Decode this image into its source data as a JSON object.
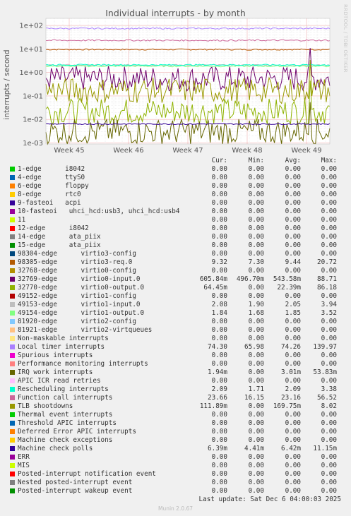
{
  "chart_data": {
    "type": "line",
    "title": "Individual interrupts - by month",
    "side_label": "RRDTOOL / TOBI OETIKER",
    "ylabel": "interrupts / second",
    "y_scale": "log",
    "ylim": [
      0.0009,
      200
    ],
    "y_ticks": [
      "1e+02",
      "1e+01",
      "1e+00",
      "1e-01",
      "1e-02",
      "1e-03"
    ],
    "x_ticks": [
      "Week 45",
      "Week 46",
      "Week 47",
      "Week 48",
      "Week 49"
    ],
    "grid": true,
    "legend_headers": [
      "Cur:",
      "Min:",
      "Avg:",
      "Max:"
    ],
    "series": [
      {
        "name": "1-edge      i8042",
        "color": "#00cc00",
        "values": [
          "0.00",
          "0.00",
          "0.00",
          "0.00"
        ]
      },
      {
        "name": "4-edge      ttyS0",
        "color": "#0066b3",
        "values": [
          "0.00",
          "0.00",
          "0.00",
          "0.00"
        ]
      },
      {
        "name": "6-edge      floppy",
        "color": "#ff8000",
        "values": [
          "0.00",
          "0.00",
          "0.00",
          "0.00"
        ]
      },
      {
        "name": "8-edge      rtc0",
        "color": "#ffcc00",
        "values": [
          "0.00",
          "0.00",
          "0.00",
          "0.00"
        ]
      },
      {
        "name": "9-fasteoi   acpi",
        "color": "#330099",
        "values": [
          "0.00",
          "0.00",
          "0.00",
          "0.00"
        ]
      },
      {
        "name": "10-fasteoi   uhci_hcd:usb3, uhci_hcd:usb4",
        "color": "#990099",
        "values": [
          "0.00",
          "0.00",
          "0.00",
          "0.00"
        ]
      },
      {
        "name": "11",
        "color": "#ccff00",
        "values": [
          "0.00",
          "0.00",
          "0.00",
          "0.00"
        ]
      },
      {
        "name": "12-edge      i8042",
        "color": "#ff0000",
        "values": [
          "0.00",
          "0.00",
          "0.00",
          "0.00"
        ]
      },
      {
        "name": "14-edge      ata_piix",
        "color": "#808080",
        "values": [
          "0.00",
          "0.00",
          "0.00",
          "0.00"
        ]
      },
      {
        "name": "15-edge      ata_piix",
        "color": "#008f00",
        "values": [
          "0.00",
          "0.00",
          "0.00",
          "0.00"
        ]
      },
      {
        "name": "98304-edge      virtio3-config",
        "color": "#00487d",
        "values": [
          "0.00",
          "0.00",
          "0.00",
          "0.00"
        ]
      },
      {
        "name": "98305-edge      virtio3-req.0",
        "color": "#b35a00",
        "values": [
          "9.32",
          "7.30",
          "9.44",
          "20.72"
        ]
      },
      {
        "name": "32768-edge      virtio0-config",
        "color": "#b38f00",
        "values": [
          "0.00",
          "0.00",
          "0.00",
          "0.00"
        ]
      },
      {
        "name": "32769-edge      virtio0-input.0",
        "color": "#6b006b",
        "values": [
          "605.84m",
          "496.70m",
          "543.58m",
          "88.71"
        ]
      },
      {
        "name": "32770-edge      virtio0-output.0",
        "color": "#8fb300",
        "values": [
          "64.45m",
          "0.00",
          "22.39m",
          "86.18"
        ]
      },
      {
        "name": "49152-edge      virtio1-config",
        "color": "#b30000",
        "values": [
          "0.00",
          "0.00",
          "0.00",
          "0.00"
        ]
      },
      {
        "name": "49153-edge      virtio1-input.0",
        "color": "#bebebe",
        "values": [
          "2.08",
          "1.90",
          "2.05",
          "3.94"
        ]
      },
      {
        "name": "49154-edge      virtio1-output.0",
        "color": "#80ff80",
        "values": [
          "1.84",
          "1.68",
          "1.85",
          "3.52"
        ]
      },
      {
        "name": "81920-edge      virtio2-config",
        "color": "#80c9ff",
        "values": [
          "0.00",
          "0.00",
          "0.00",
          "0.00"
        ]
      },
      {
        "name": "81921-edge      virtio2-virtqueues",
        "color": "#ffc080",
        "values": [
          "0.00",
          "0.00",
          "0.00",
          "0.00"
        ]
      },
      {
        "name": "Non-maskable interrupts",
        "color": "#ffe680",
        "values": [
          "0.00",
          "0.00",
          "0.00",
          "0.00"
        ]
      },
      {
        "name": "Local timer interrupts",
        "color": "#aa80ff",
        "values": [
          "74.30",
          "65.98",
          "74.26",
          "139.97"
        ]
      },
      {
        "name": "Spurious interrupts",
        "color": "#ee00cc",
        "values": [
          "0.00",
          "0.00",
          "0.00",
          "0.00"
        ]
      },
      {
        "name": "Performance monitoring interrupts",
        "color": "#ff8080",
        "values": [
          "0.00",
          "0.00",
          "0.00",
          "0.00"
        ]
      },
      {
        "name": "IRQ work interrupts",
        "color": "#666600",
        "values": [
          "1.94m",
          "0.00",
          "3.01m",
          "53.83m"
        ]
      },
      {
        "name": "APIC ICR read retries",
        "color": "#ffbfff",
        "values": [
          "0.00",
          "0.00",
          "0.00",
          "0.00"
        ]
      },
      {
        "name": "Rescheduling interrupts",
        "color": "#00ffcc",
        "values": [
          "2.09",
          "1.71",
          "2.09",
          "3.38"
        ]
      },
      {
        "name": "Function call interrupts",
        "color": "#cc6699",
        "values": [
          "23.66",
          "16.15",
          "23.16",
          "56.52"
        ]
      },
      {
        "name": "TLB shootdowns",
        "color": "#999900",
        "values": [
          "111.89m",
          "0.00",
          "169.75m",
          "8.02"
        ]
      },
      {
        "name": "Thermal event interrupts",
        "color": "#00cc00",
        "values": [
          "0.00",
          "0.00",
          "0.00",
          "0.00"
        ]
      },
      {
        "name": "Threshold APIC interrupts",
        "color": "#0066b3",
        "values": [
          "0.00",
          "0.00",
          "0.00",
          "0.00"
        ]
      },
      {
        "name": "Deferred Error APIC interrupts",
        "color": "#ff8000",
        "values": [
          "0.00",
          "0.00",
          "0.00",
          "0.00"
        ]
      },
      {
        "name": "Machine check exceptions",
        "color": "#ffcc00",
        "values": [
          "0.00",
          "0.00",
          "0.00",
          "0.00"
        ]
      },
      {
        "name": "Machine check polls",
        "color": "#330099",
        "values": [
          "6.39m",
          "4.41m",
          "6.42m",
          "11.15m"
        ]
      },
      {
        "name": "ERR",
        "color": "#990099",
        "values": [
          "0.00",
          "0.00",
          "0.00",
          "0.00"
        ]
      },
      {
        "name": "MIS",
        "color": "#ccff00",
        "values": [
          "0.00",
          "0.00",
          "0.00",
          "0.00"
        ]
      },
      {
        "name": "Posted-interrupt notification event",
        "color": "#ff0000",
        "values": [
          "0.00",
          "0.00",
          "0.00",
          "0.00"
        ]
      },
      {
        "name": "Nested posted-interrupt event",
        "color": "#808080",
        "values": [
          "0.00",
          "0.00",
          "0.00",
          "0.00"
        ]
      },
      {
        "name": "Posted-interrupt wakeup event",
        "color": "#008f00",
        "values": [
          "0.00",
          "0.00",
          "0.00",
          "0.00"
        ]
      }
    ],
    "last_update": "Last update: Sat Dec  6 04:00:03 2025",
    "footer": "Munin 2.0.67"
  }
}
